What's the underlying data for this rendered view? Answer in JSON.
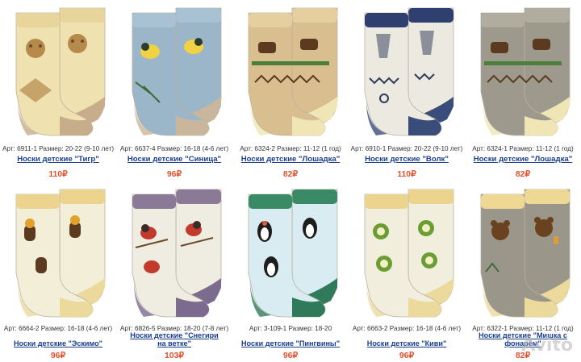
{
  "products": [
    {
      "meta": "Арт: 6911-1  Размер: 20-22 (9-10 лет)",
      "title": "Носки детские \"Тигр\"",
      "price": "110₽",
      "colors": {
        "base": "#efe2b0",
        "toe": "#c7ad89",
        "accent": "#6b4b2e",
        "cuff": "#e8d59b",
        "pattern": "#b58a4b"
      },
      "motif": "tiger"
    },
    {
      "meta": "Арт: 6637-4  Размер: 16-18 (4-6 лет)",
      "title": "Носки детские \"Синица\"",
      "price": "96₽",
      "colors": {
        "base": "#9bb6c8",
        "toe": "#c9b69c",
        "accent": "#2d3b2a",
        "cuff": "#a8c2d3",
        "pattern": "#f1d243"
      },
      "motif": "bird"
    },
    {
      "meta": "Арт: 6324-2  Размер: 11-12 (1 год)",
      "title": "Носки детские \"Лошадка\"",
      "price": "82₽",
      "colors": {
        "base": "#d9bf8f",
        "toe": "#f0e6b5",
        "accent": "#5b3a20",
        "cuff": "#e6cf9e",
        "pattern": "#4d7f3c"
      },
      "motif": "horse"
    },
    {
      "meta": "Арт: 6910-1  Размер: 20-22 (9-10 лет)",
      "title": "Носки детские \"Волк\"",
      "price": "110₽",
      "colors": {
        "base": "#ece9e1",
        "toe": "#3a4d7a",
        "accent": "#2f3a5a",
        "cuff": "#2f3f70",
        "pattern": "#8b8f99"
      },
      "motif": "wolf"
    },
    {
      "meta": "Арт: 6324-1  Размер: 11-12 (1 год)",
      "title": "Носки детские \"Лошадка\"",
      "price": "82₽",
      "colors": {
        "base": "#9d9a8d",
        "toe": "#f0e6b5",
        "accent": "#5b3a20",
        "cuff": "#b0ad9f",
        "pattern": "#4d7f3c"
      },
      "motif": "horse"
    },
    {
      "meta": "Арт: 6664-2  Размер: 16-18 (4-6 лет)",
      "title": "Носки детские \"Эскимо\"",
      "price": "96₽",
      "colors": {
        "base": "#f2eed8",
        "toe": "#ecd99c",
        "accent": "#5b3a20",
        "cuff": "#ecd48f",
        "pattern": "#e3a02a"
      },
      "motif": "icecream"
    },
    {
      "meta": "Арт: 6826-5  Размер: 18-20 (7-8 лет)",
      "title": "Носки детские \"Снегири на ветке\"",
      "price": "103₽",
      "colors": {
        "base": "#efece2",
        "toe": "#7d6a8f",
        "accent": "#3a2a2a",
        "cuff": "#8a7a98",
        "pattern": "#c23a2c"
      },
      "motif": "bullfinch"
    },
    {
      "meta": "Арт: 3-109-1  Размер: 18-20",
      "title": "Носки детские \"Пингвины\"",
      "price": "96₽",
      "colors": {
        "base": "#d8ecf2",
        "toe": "#2f7a5a",
        "accent": "#1d1d1d",
        "cuff": "#3b8a66",
        "pattern": "#e05a3c"
      },
      "motif": "penguin"
    },
    {
      "meta": "Арт: 6663-2  Размер: 16-18 (4-6 лет)",
      "title": "Носки детские \"Киви\"",
      "price": "96₽",
      "colors": {
        "base": "#f1eede",
        "toe": "#ecd99c",
        "accent": "#2c6a2a",
        "cuff": "#ecd48f",
        "pattern": "#6b9d32"
      },
      "motif": "kiwi"
    },
    {
      "meta": "Арт: 6322-1  Размер: 11-12 (1 год)",
      "title": "Носки детские \"Мишка с фонарём\"",
      "price": "82₽",
      "colors": {
        "base": "#9a978a",
        "toe": "#ecd99c",
        "accent": "#6b4220",
        "cuff": "#efd894",
        "pattern": "#e09a3a"
      },
      "motif": "bear"
    }
  ],
  "watermark": "Avito"
}
